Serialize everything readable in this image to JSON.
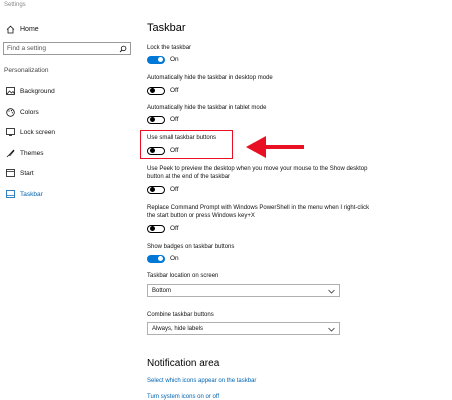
{
  "window": {
    "title": "Settings"
  },
  "sidebar": {
    "home_label": "Home",
    "search_placeholder": "Find a setting",
    "section_label": "Personalization",
    "items": [
      {
        "label": "Background",
        "icon": "picture-icon"
      },
      {
        "label": "Colors",
        "icon": "palette-icon"
      },
      {
        "label": "Lock screen",
        "icon": "lock-screen-icon"
      },
      {
        "label": "Themes",
        "icon": "brush-icon"
      },
      {
        "label": "Start",
        "icon": "start-icon"
      },
      {
        "label": "Taskbar",
        "icon": "taskbar-icon",
        "selected": true
      }
    ]
  },
  "main": {
    "title": "Taskbar",
    "settings": [
      {
        "label": "Lock the taskbar",
        "state": "On"
      },
      {
        "label": "Automatically hide the taskbar in desktop mode",
        "state": "Off"
      },
      {
        "label": "Automatically hide the taskbar in tablet mode",
        "state": "Off"
      },
      {
        "label": "Use small taskbar buttons",
        "state": "Off"
      },
      {
        "label": "Use Peek to preview the desktop when you move your mouse to the Show desktop button at the end of the taskbar",
        "state": "Off"
      },
      {
        "label": "Replace Command Prompt with Windows PowerShell in the menu when I right-click the start button or press Windows key+X",
        "state": "Off"
      },
      {
        "label": "Show badges on taskbar buttons",
        "state": "On"
      }
    ],
    "location_label": "Taskbar location on screen",
    "location_value": "Bottom",
    "combine_label": "Combine taskbar buttons",
    "combine_value": "Always, hide labels",
    "notification_title": "Notification area",
    "links": [
      "Select which icons appear on the taskbar",
      "Turn system icons on or off"
    ]
  },
  "colors": {
    "accent": "#0078d7",
    "highlight": "#e81123",
    "link": "#0063b1"
  }
}
